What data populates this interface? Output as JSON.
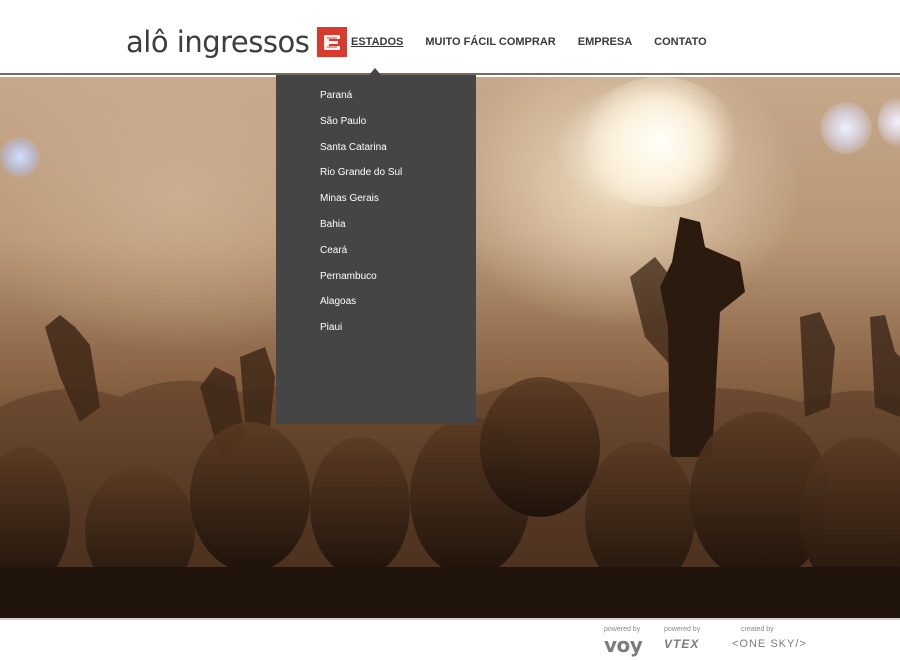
{
  "logo": {
    "text": "alô ingressos",
    "accent_color": "#d93a2b"
  },
  "nav": {
    "items": [
      {
        "label": "ESTADOS"
      },
      {
        "label": "MUITO FÁCIL COMPRAR"
      },
      {
        "label": "EMPRESA"
      },
      {
        "label": "CONTATO"
      }
    ]
  },
  "dropdown": {
    "items": [
      {
        "label": "Paraná"
      },
      {
        "label": "São Paulo"
      },
      {
        "label": "Santa Catarina"
      },
      {
        "label": "Rio Grande do Sul"
      },
      {
        "label": "Minas Gerais"
      },
      {
        "label": "Bahia"
      },
      {
        "label": "Ceará"
      },
      {
        "label": "Pernambuco"
      },
      {
        "label": "Alagoas"
      },
      {
        "label": "Piaui"
      }
    ]
  },
  "hero": {
    "image_subject": "concert crowd with raised hands"
  },
  "footer": {
    "credits": [
      {
        "caption": "powered by",
        "name": "voy"
      },
      {
        "caption": "powered by",
        "name": "VTEX"
      },
      {
        "caption": "created by",
        "name": "<ONE SKY/>"
      }
    ]
  }
}
